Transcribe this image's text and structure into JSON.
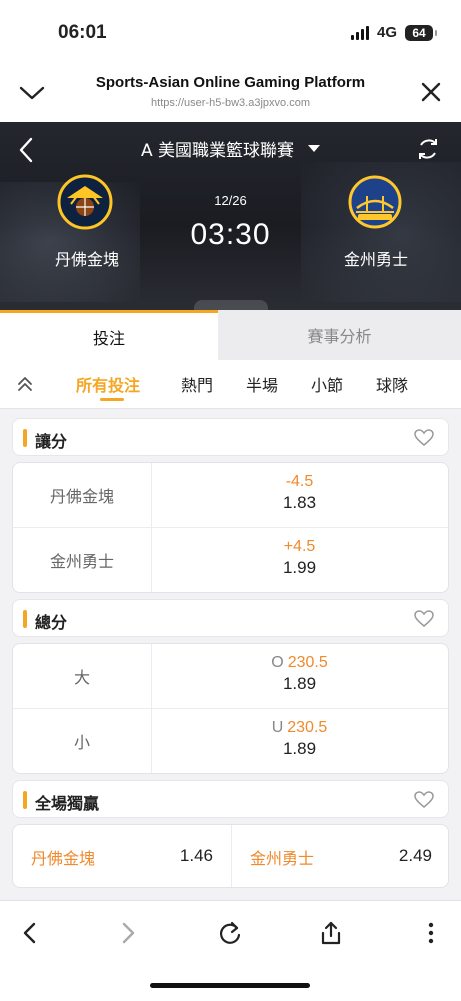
{
  "status_bar": {
    "time": "06:01",
    "network": "4G",
    "battery": "64"
  },
  "browser": {
    "title": "Sports-Asian Online Gaming Platform",
    "url": "https://user-h5-bw3.a3jpxvo.com",
    "icons": {
      "collapse": "chevron-down-icon",
      "close": "close-icon"
    }
  },
  "match": {
    "league": "A 美國職業籃球聯賽",
    "date": "12/26",
    "time": "03:30",
    "home_team": "丹佛金塊",
    "away_team": "金州勇士",
    "home_logo_text": "NUGGETS",
    "away_logo_text": "WARRIORS",
    "colors": {
      "home_primary": "#0e2240",
      "home_gold": "#fec524",
      "away_blue": "#1d428a",
      "away_gold": "#ffc72c"
    }
  },
  "main_tabs": [
    {
      "label": "投注",
      "active": true
    },
    {
      "label": "賽事分析",
      "active": false
    }
  ],
  "filters": [
    {
      "label": "所有投注",
      "active": true
    },
    {
      "label": "熱門",
      "active": false
    },
    {
      "label": "半場",
      "active": false
    },
    {
      "label": "小節",
      "active": false
    },
    {
      "label": "球隊",
      "active": false
    }
  ],
  "markets": {
    "spread": {
      "title": "讓分",
      "rows": [
        {
          "label": "丹佛金塊",
          "line": "-4.5",
          "odds": "1.83"
        },
        {
          "label": "金州勇士",
          "line": "+4.5",
          "odds": "1.99"
        }
      ]
    },
    "total": {
      "title": "總分",
      "rows": [
        {
          "label": "大",
          "prefix": "O",
          "line": "230.5",
          "odds": "1.89"
        },
        {
          "label": "小",
          "prefix": "U",
          "line": "230.5",
          "odds": "1.89"
        }
      ]
    },
    "moneyline": {
      "title": "全場獨贏",
      "cells": [
        {
          "team": "丹佛金塊",
          "odds": "1.46"
        },
        {
          "team": "金州勇士",
          "odds": "2.49"
        }
      ]
    }
  },
  "theme": {
    "accent": "#f5a623",
    "odds_orange": "#f08a2c"
  }
}
